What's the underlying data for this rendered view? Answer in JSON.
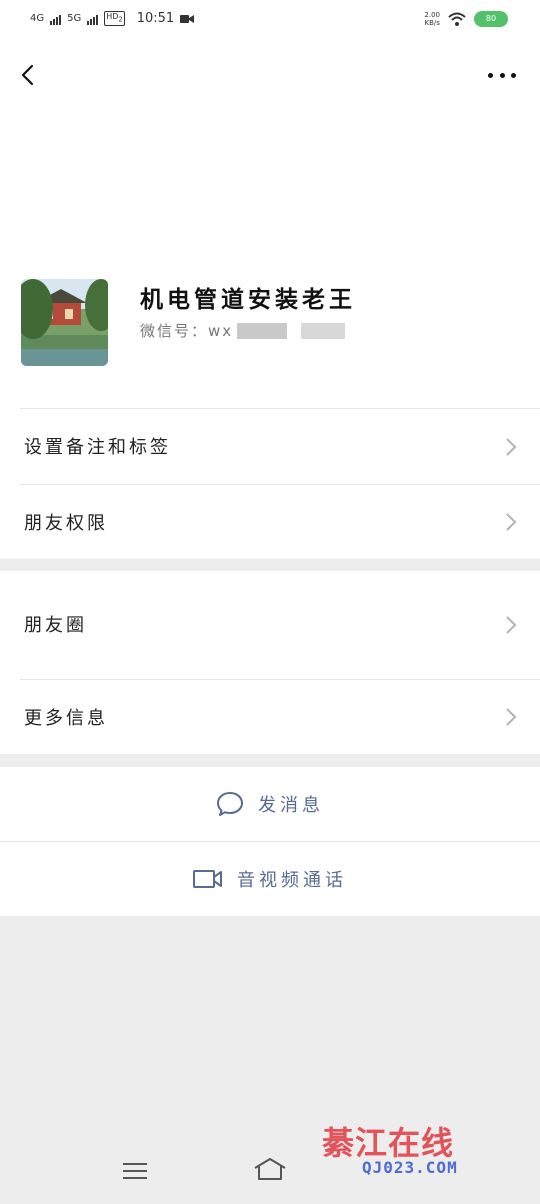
{
  "status_bar": {
    "signal_1": "4G",
    "signal_2": "5G",
    "hd": "HD",
    "hd_sub": "2",
    "time": "10:51",
    "speed_value": "2.00",
    "speed_unit": "KB/s",
    "battery": "80"
  },
  "profile": {
    "name": "机电管道安装老王",
    "wechat_id_label": "微信号：wx"
  },
  "menu_group_1": [
    {
      "label": "设置备注和标签"
    },
    {
      "label": "朋友权限"
    }
  ],
  "menu_group_2": [
    {
      "label": "朋友圈"
    },
    {
      "label": "更多信息"
    }
  ],
  "actions": {
    "send_message": "发消息",
    "video_call": "音视频通话"
  },
  "watermark": {
    "main": "綦江在线",
    "sub": "QJ023.COM"
  },
  "colors": {
    "link": "#576b95",
    "battery": "#53c06a",
    "background": "#ededed"
  }
}
